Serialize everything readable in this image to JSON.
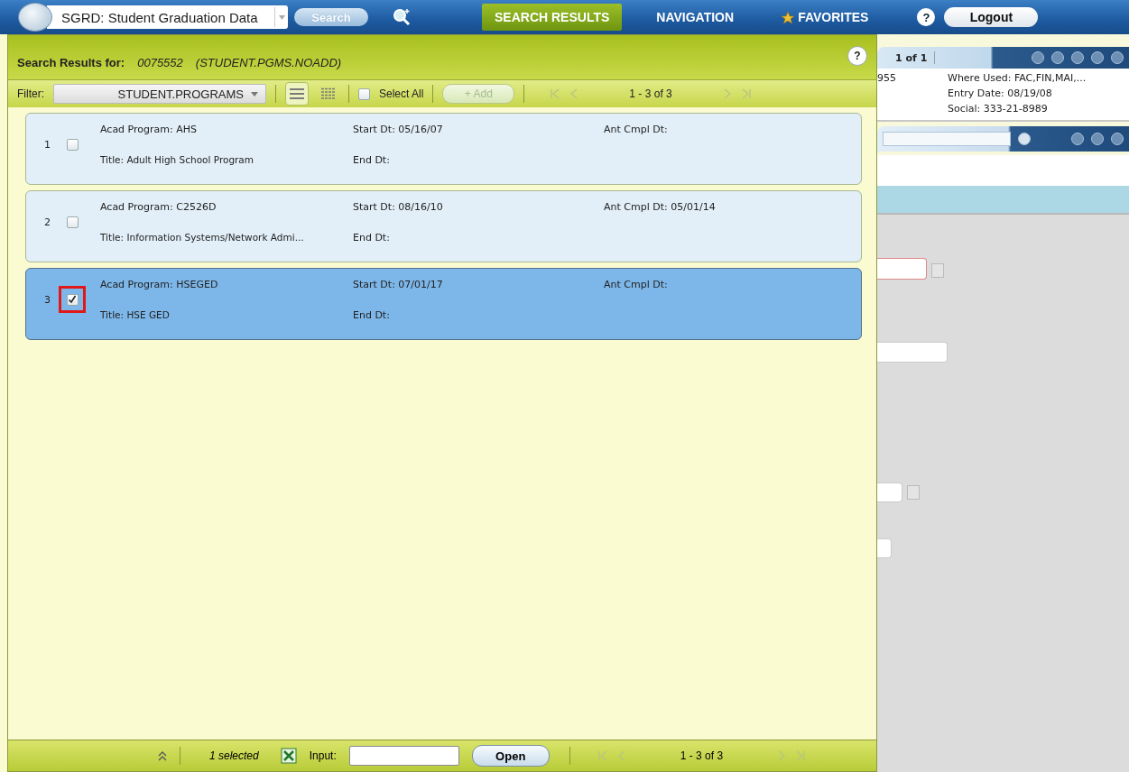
{
  "app": {
    "module_field": "SGRD: Student Graduation Data",
    "search_button": "Search"
  },
  "nav_tabs": [
    {
      "label": "SEARCH RESULTS",
      "selected": true
    },
    {
      "label": "NAVIGATION",
      "selected": false
    },
    {
      "label": "FAVORITES",
      "selected": false
    }
  ],
  "help_button": "?",
  "logout_button": "Logout",
  "results": {
    "heading": "Search Results for:",
    "query": "0075552",
    "process": "(STUDENT.PGMS.NOADD)",
    "help_button": "?",
    "filter_label": "Filter:",
    "filter_value": "STUDENT.PROGRAMS",
    "select_all": {
      "label": "Select All",
      "checked": false
    },
    "add_button": "+ Add",
    "range": "1 - 3 of 3",
    "rows": [
      {
        "number": "1",
        "selected": false,
        "checked": false,
        "highlighted": false,
        "program": "Acad Program: AHS",
        "start": "Start Dt: 05/16/07",
        "ant_cmpl": "Ant Cmpl Dt:",
        "title": "Title: Adult High School Program",
        "end": "End Dt:"
      },
      {
        "number": "2",
        "selected": false,
        "checked": false,
        "highlighted": false,
        "program": "Acad Program: C2526D",
        "start": "Start Dt: 08/16/10",
        "ant_cmpl": "Ant Cmpl Dt: 05/01/14",
        "title": "Title: Information Systems/Network Admi...",
        "end": "End Dt:"
      },
      {
        "number": "3",
        "selected": true,
        "checked": true,
        "highlighted": true,
        "program": "Acad Program: HSEGED",
        "start": "Start Dt: 07/01/17",
        "ant_cmpl": "Ant Cmpl Dt:",
        "title": "Title: HSE GED",
        "end": "End Dt:"
      }
    ],
    "footer": {
      "selected_count": "1 selected",
      "input_label": "Input:",
      "open_button": "Open",
      "range": "1 - 3 of 3"
    }
  },
  "background": {
    "record_pager": "1 of 1",
    "id_fragment": "955",
    "where_used": "Where Used: FAC,FIN,MAI,...",
    "entry_date": "Entry Date: 08/19/08",
    "social": "Social: 333-21-8989"
  }
}
